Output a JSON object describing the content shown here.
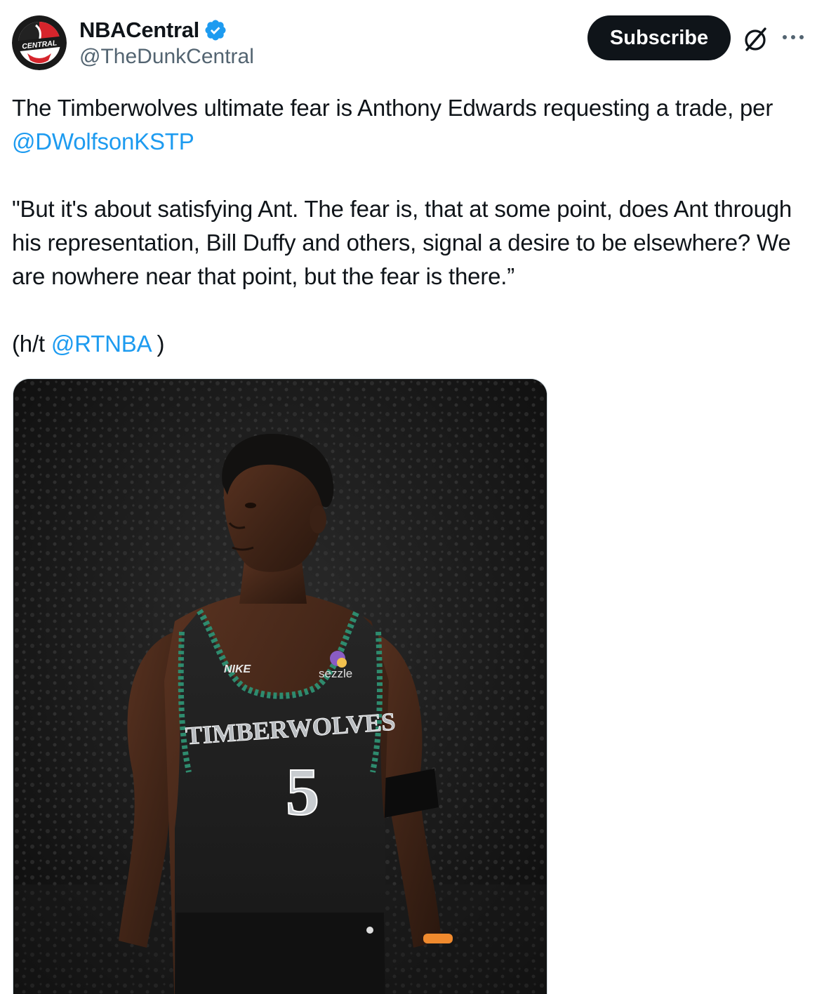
{
  "account": {
    "display_name": "NBACentral",
    "handle": "@TheDunkCentral",
    "avatar_logo_text": "CENTRAL",
    "verified": true
  },
  "header": {
    "subscribe_label": "Subscribe"
  },
  "post": {
    "line1_text": "The Timberwolves ultimate fear is Anthony Edwards requesting a trade, per ",
    "line1_mention": "@DWolfsonKSTP",
    "quote": "\"But it's about satisfying Ant. The fear is, that at some point, does Ant through his representation, Bill Duffy and others, signal a desire to be elsewhere? We are nowhere near that point, but the fear is there.”",
    "hat_tip_prefix": "(h/t ",
    "hat_tip_mention": "@RTNBA",
    "hat_tip_suffix": " )"
  },
  "media": {
    "jersey_brand": "NIKE",
    "jersey_sponsor": "sezzle",
    "jersey_team": "TIMBERWOLVES",
    "jersey_number": "5"
  },
  "colors": {
    "accent": "#1d9bf0",
    "text_primary": "#0f1419",
    "text_secondary": "#536471",
    "button_bg": "#0f1419",
    "jersey_trim": "#2e8b6e"
  },
  "icons": [
    "verified-badge-icon",
    "grok-icon",
    "more-options-icon"
  ]
}
